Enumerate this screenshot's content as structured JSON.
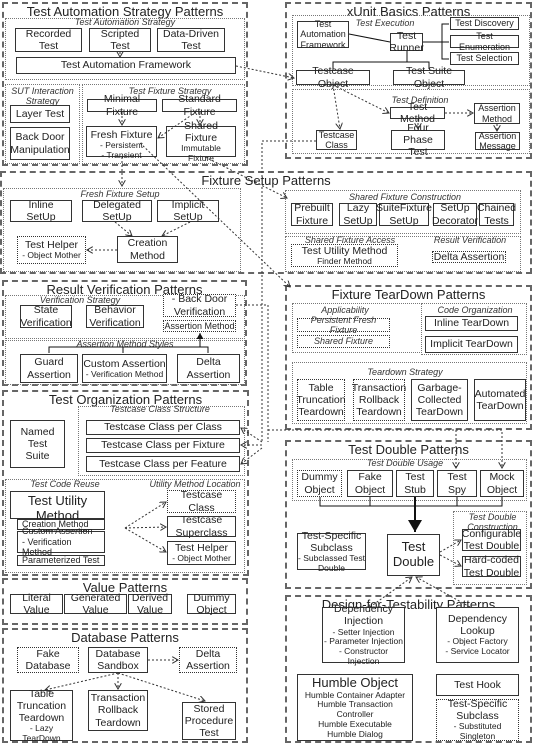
{
  "tas": {
    "title": "Test Automation Strategy Patterns",
    "strategy_label": "Test Automation Strategy",
    "recorded": "Recorded\nTest",
    "scripted": "Scripted\nTest",
    "data_driven": "Data-Driven\nTest",
    "framework": "Test Automation Framework",
    "sut_label": "SUT Interaction\nStrategy",
    "layer_test": "Layer Test",
    "back_door": "Back Door\nManipulation",
    "fixture_label": "Test Fixture Strategy",
    "minimal": "Minimal Fixture",
    "standard": "Standard Fixture",
    "fresh": {
      "label": "Fresh Fixture",
      "items": [
        "- Persistent",
        "- Transient"
      ]
    },
    "shared": {
      "label": "Shared Fixture",
      "items": [
        "Immutable Fixture"
      ]
    }
  },
  "xunit": {
    "title": "xUnit Basics Patterns",
    "execution_label": "Test Execution",
    "framework": "Test\nAutomation\nFramework",
    "runner": "Test\nRunner",
    "discovery": "Test Discovery",
    "enumeration": "Test Enumeration",
    "selection": "Test Selection",
    "testcase_object": "Testcase Object",
    "suite_object": "Test Suite Object",
    "definition_label": "Test Definition",
    "test_method": "Test Method",
    "assertion_method": "Assertion\nMethod",
    "testcase_class": "Testcase\nClass",
    "four_phase": "Four Phase\nTest",
    "assertion_message": "Assertion\nMessage"
  },
  "setup": {
    "title": "Fixture Setup Patterns",
    "fresh_label": "Fresh Fixture Setup",
    "inline": "Inline\nSetUp",
    "delegated": "Delegated\nSetUp",
    "implicit": "Implicit\nSetUp",
    "test_helper": {
      "label": "Test Helper",
      "items": [
        "- Object Mother"
      ]
    },
    "creation": "Creation\nMethod",
    "shared_label": "Shared Fixture Construction",
    "prebuilt": "Prebuilt\nFixture",
    "lazy": "Lazy\nSetUp",
    "suite_fixture": "SuiteFixture\nSetUp",
    "decorator": "SetUp\nDecorator",
    "chained": "Chained\nTests",
    "access_label": "Shared Fixture Access",
    "utility": {
      "label": "Test Utility Method",
      "items": [
        "Finder Method"
      ]
    },
    "verification_label": "Result Verification",
    "delta": "Delta Assertion"
  },
  "verification": {
    "title": "Result Verification Patterns",
    "strategy_label": "Verification Strategy",
    "state": "State\nVerification",
    "behavior": "Behavior\nVerification",
    "back_door": "- Back Door\nVerification",
    "assertion_method": "Assertion Method",
    "styles_label": "Assertion Method Styles",
    "guard": "Guard\nAssertion",
    "custom": {
      "label": "Custom Assertion",
      "items": [
        "- Verification Method"
      ]
    },
    "delta": "Delta\nAssertion"
  },
  "teardown": {
    "title": "Fixture TearDown Patterns",
    "applicability_label": "Applicability",
    "persistent": "Persistent Fresh Fixture",
    "shared": "Shared Fixture",
    "code_label": "Code Organization",
    "inline": "Inline TearDown",
    "implicit": "Implicit TearDown",
    "strategy_label": "Teardown Strategy",
    "table_truncation": "Table\nTruncation\nTeardown",
    "transaction_rollback": "Transaction\nRollback\nTeardown",
    "garbage": "Garbage-\nCollected\nTearDown",
    "automated": "Automated\nTearDown"
  },
  "organization": {
    "title": "Test Organization Patterns",
    "structure_label": "Testcase Class Structure",
    "named_suite": "Named\nTest\nSuite",
    "per_class": "Testcase Class per Class",
    "per_fixture": "Testcase Class per Fixture",
    "per_feature": "Testcase Class per Feature",
    "reuse_label": "Test Code Reuse",
    "location_label": "Utility Method Location",
    "utility": {
      "label": "Test Utility Method",
      "items": [
        "- Finder Method"
      ]
    },
    "creation": "Creation Method",
    "custom": "Custom Assertion\n - Verification Method",
    "parameterized": "Parameterized Test",
    "testcase_class": "Testcase\nClass",
    "superclass": "Testcase\nSuperclass",
    "helper": {
      "label": "Test Helper",
      "items": [
        "- Object Mother"
      ]
    }
  },
  "double": {
    "title": "Test Double Patterns",
    "usage_label": "Test Double Usage",
    "dummy": "Dummy\nObject",
    "fake": "Fake\nObject",
    "stub": "Test\nStub",
    "spy": "Test\nSpy",
    "mock": "Mock\nObject",
    "subclass": {
      "label": "Test-Specific\nSubclass",
      "items": [
        "- Subclassed Test\nDouble"
      ]
    },
    "test_double": "Test\nDouble",
    "construction_label": "Test Double\nConstruction",
    "configurable": "Configurable\nTest Double",
    "hard_coded": "Hard-coded\nTest Double"
  },
  "value": {
    "title": "Value Patterns",
    "literal": "Literal\nValue",
    "generated": "Generated\nValue",
    "derived": "Derived\nValue",
    "dummy": "Dummy\nObject"
  },
  "database": {
    "title": "Database Patterns",
    "fake": "Fake\nDatabase",
    "sandbox": "Database\nSandbox",
    "delta": "Delta\nAssertion",
    "table_truncation": {
      "label": "Table\nTruncation\nTeardown",
      "items": [
        "- Lazy TearDown"
      ]
    },
    "transaction_rollback": "Transaction\nRollback\nTeardown",
    "stored_procedure": "Stored\nProcedure\nTest"
  },
  "dft": {
    "title": "Design-for-Testability Patterns",
    "injection": {
      "label": "Dependency\nInjection",
      "items": [
        "- Setter Injection",
        "- Parameter Injection",
        "- Constructor Injection"
      ]
    },
    "lookup": {
      "label": "Dependency\nLookup",
      "items": [
        "- Object Factory",
        "- Service Locator"
      ]
    },
    "humble": {
      "label": "Humble Object",
      "items": [
        "Humble Container Adapter",
        "Humble Transaction Controller",
        "Humble Executable",
        "Humble Dialog"
      ]
    },
    "hook": "Test Hook",
    "subclass": {
      "label": "Test-Specific\nSubclass",
      "items": [
        "- Substituted Singleton"
      ]
    }
  }
}
